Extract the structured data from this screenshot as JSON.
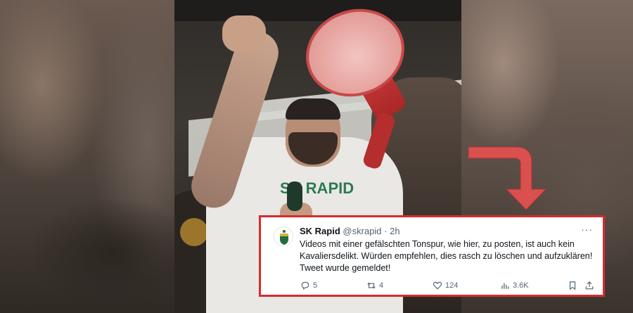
{
  "tweet": {
    "author_name": "SK Rapid",
    "author_handle": "@skrapid",
    "separator": "·",
    "time": "2h",
    "more_icon": "more-horizontal-icon",
    "text_line1": "Videos mit einer gefälschten Tonspur, wie hier, zu posten, ist auch kein",
    "text_line2": "Kavaliersdelikt. Würden empfehlen, dies rasch zu löschen und aufzuklären!",
    "text_line3": "Tweet wurde gemeldet!",
    "actions": {
      "reply_count": "5",
      "retweet_count": "4",
      "like_count": "124",
      "views_count": "3.6K"
    }
  },
  "photo": {
    "shirt_text": "SK RAPID"
  },
  "colors": {
    "highlight_border": "#d62c2c",
    "arrow": "#d9504f",
    "text_primary": "#0f1419",
    "text_secondary": "#536471",
    "club_green": "#2d7a52"
  },
  "icons": [
    "reply-icon",
    "retweet-icon",
    "like-icon",
    "views-icon",
    "bookmark-icon",
    "share-icon",
    "club-crest-icon",
    "arrow-icon"
  ]
}
